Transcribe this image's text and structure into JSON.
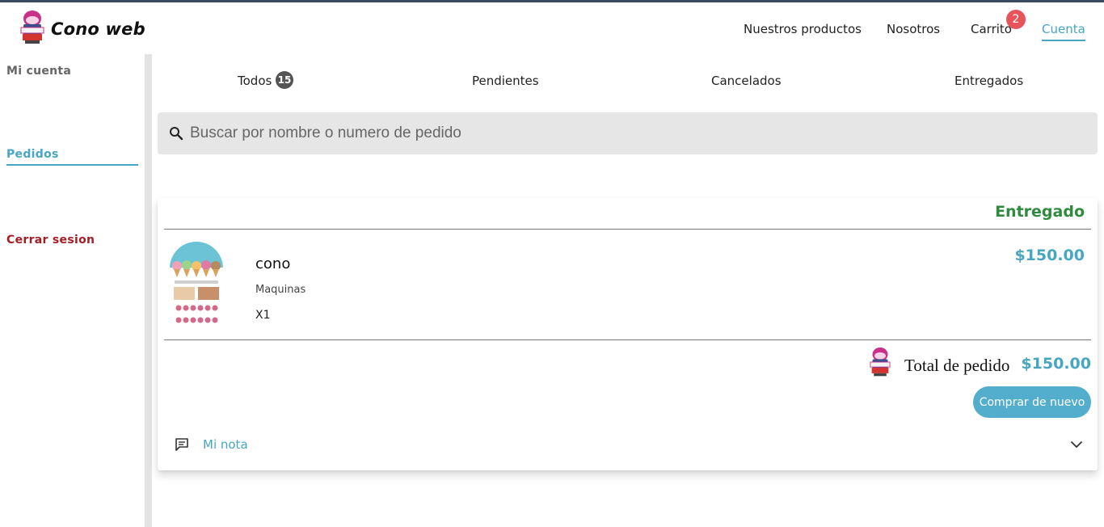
{
  "header": {
    "brand": "Cono web",
    "nav": {
      "products": "Nuestros productos",
      "about": "Nosotros",
      "cart": "Carrito",
      "cart_count": "2",
      "account": "Cuenta"
    }
  },
  "sidebar": {
    "account": "Mi cuenta",
    "orders": "Pedidos",
    "logout": "Cerrar sesion"
  },
  "tabs": {
    "all": "Todos",
    "all_count": "15",
    "pending": "Pendientes",
    "cancelled": "Cancelados",
    "delivered": "Entregados"
  },
  "search": {
    "placeholder": "Buscar por nombre o numero de pedido",
    "value": ""
  },
  "order": {
    "status": "Entregado",
    "item": {
      "name": "cono",
      "category": "Maquinas",
      "quantity": "X1",
      "price": "$150.00"
    },
    "total_label": "Total de pedido",
    "total_value": "$150.00",
    "rebuy_label": "Comprar de nuevo",
    "note_label": "Mi nota"
  },
  "colors": {
    "accent": "#46a6c4",
    "status_delivered": "#2e8b3d",
    "logout": "#a61d24",
    "badge": "#e7555b"
  },
  "icons": {
    "search": "search-icon",
    "note": "comment-icon",
    "expand": "chevron-down-icon"
  }
}
